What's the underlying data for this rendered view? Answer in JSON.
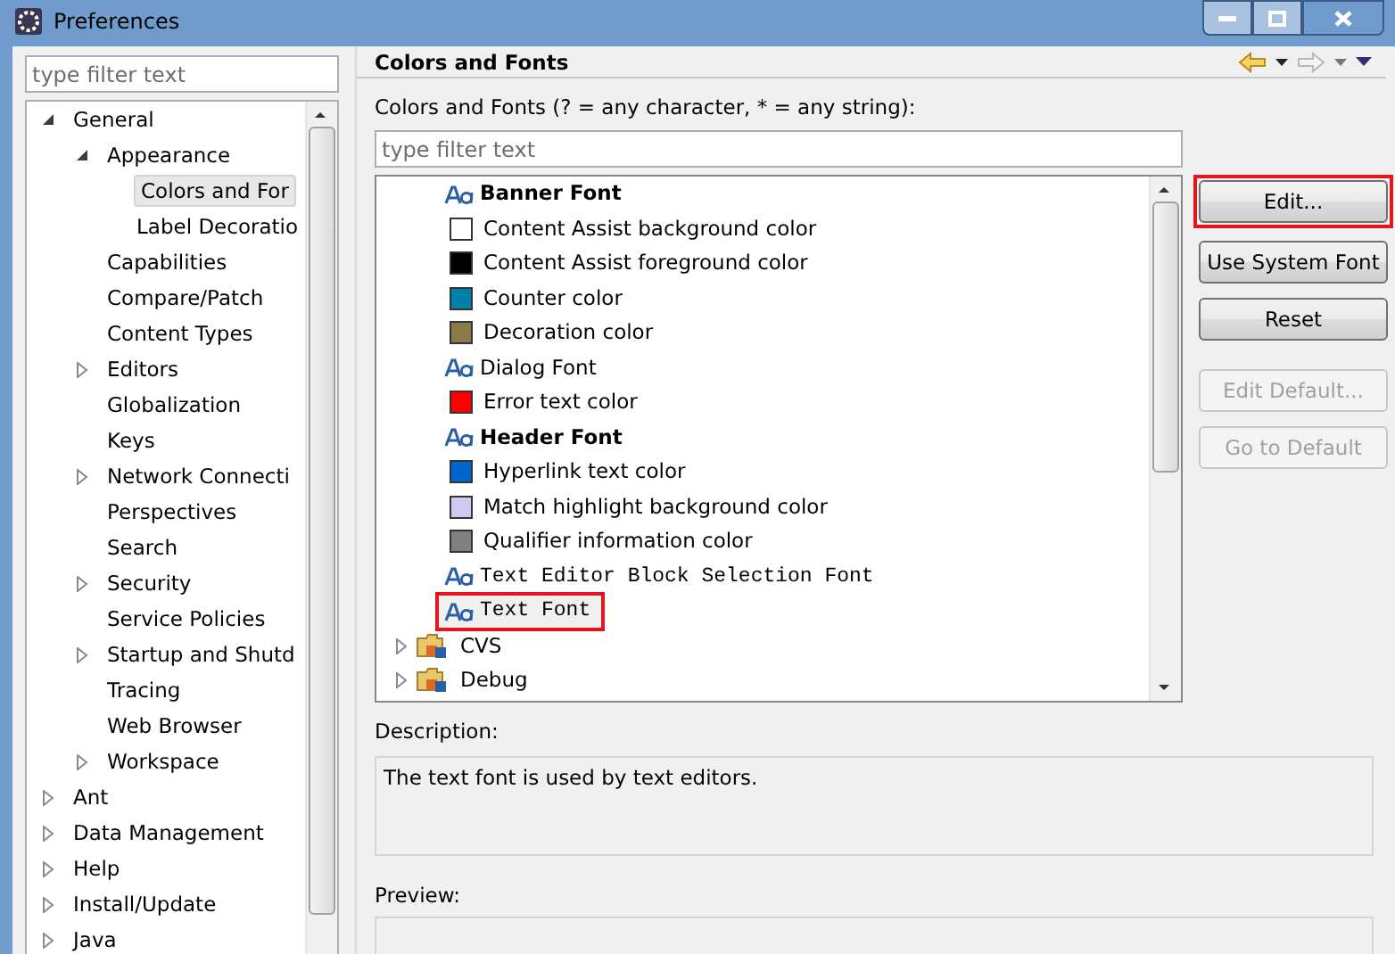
{
  "window": {
    "title": "Preferences"
  },
  "sidebar": {
    "filter": {
      "placeholder": "type filter text"
    },
    "tree": [
      {
        "label": "General",
        "expanded": true,
        "children": [
          {
            "label": "Appearance",
            "expanded": true,
            "children": [
              {
                "label": "Colors and For",
                "selected": true
              },
              {
                "label": "Label Decoratio",
                "selected": false
              }
            ]
          },
          {
            "label": "Capabilities"
          },
          {
            "label": "Compare/Patch"
          },
          {
            "label": "Content Types"
          },
          {
            "label": "Editors",
            "expanded": false
          },
          {
            "label": "Globalization"
          },
          {
            "label": "Keys"
          },
          {
            "label": "Network Connecti",
            "expanded": false
          },
          {
            "label": "Perspectives"
          },
          {
            "label": "Search"
          },
          {
            "label": "Security",
            "expanded": false
          },
          {
            "label": "Service Policies"
          },
          {
            "label": "Startup and Shutd",
            "expanded": false
          },
          {
            "label": "Tracing"
          },
          {
            "label": "Web Browser"
          },
          {
            "label": "Workspace",
            "expanded": false
          }
        ]
      },
      {
        "label": "Ant",
        "expanded": false
      },
      {
        "label": "Data Management",
        "expanded": false
      },
      {
        "label": "Help",
        "expanded": false
      },
      {
        "label": "Install/Update",
        "expanded": false
      },
      {
        "label": "Java",
        "expanded": false
      }
    ]
  },
  "page": {
    "title": "Colors and Fonts",
    "filter_label": "Colors and Fonts (? = any character, * = any string):",
    "filter": {
      "placeholder": "type filter text"
    },
    "items": [
      {
        "kind": "bold_font",
        "label": "Banner Font",
        "highlighted": false
      },
      {
        "kind": "color",
        "label": "Content Assist background color",
        "color": "#ffffff",
        "highlighted": false
      },
      {
        "kind": "color",
        "label": "Content Assist foreground color",
        "color": "#000000",
        "highlighted": false
      },
      {
        "kind": "color",
        "label": "Counter color",
        "color": "#0080a8",
        "highlighted": false
      },
      {
        "kind": "color",
        "label": "Decoration color",
        "color": "#8c7a48",
        "highlighted": false
      },
      {
        "kind": "font",
        "label": "Dialog Font",
        "highlighted": false
      },
      {
        "kind": "color",
        "label": "Error text color",
        "color": "#ff0000",
        "highlighted": false
      },
      {
        "kind": "bold_font",
        "label": "Header Font",
        "highlighted": false
      },
      {
        "kind": "color",
        "label": "Hyperlink text color",
        "color": "#0066cc",
        "highlighted": false
      },
      {
        "kind": "color",
        "label": "Match highlight background color",
        "color": "#cccaf0",
        "highlighted": false
      },
      {
        "kind": "color",
        "label": "Qualifier information color",
        "color": "#808080",
        "highlighted": false
      },
      {
        "kind": "mono_font",
        "label": "Text Editor Block Selection Font",
        "highlighted": false
      },
      {
        "kind": "mono_font",
        "label": "Text Font",
        "highlighted": true
      },
      {
        "kind": "category",
        "label": "CVS",
        "expanded": false
      },
      {
        "kind": "category",
        "label": "Debug",
        "expanded": false
      }
    ],
    "buttons": [
      {
        "label": "Edit...",
        "disabled": false,
        "highlighted": true
      },
      {
        "label": "Use System Font",
        "disabled": false,
        "highlighted": false
      },
      {
        "label": "Reset",
        "disabled": false,
        "highlighted": false
      },
      {
        "label": "Edit Default...",
        "disabled": true,
        "highlighted": false
      },
      {
        "label": "Go to Default",
        "disabled": true,
        "highlighted": false
      }
    ],
    "description_label": "Description:",
    "description": "The text font is used by text editors.",
    "preview_label": "Preview:"
  }
}
